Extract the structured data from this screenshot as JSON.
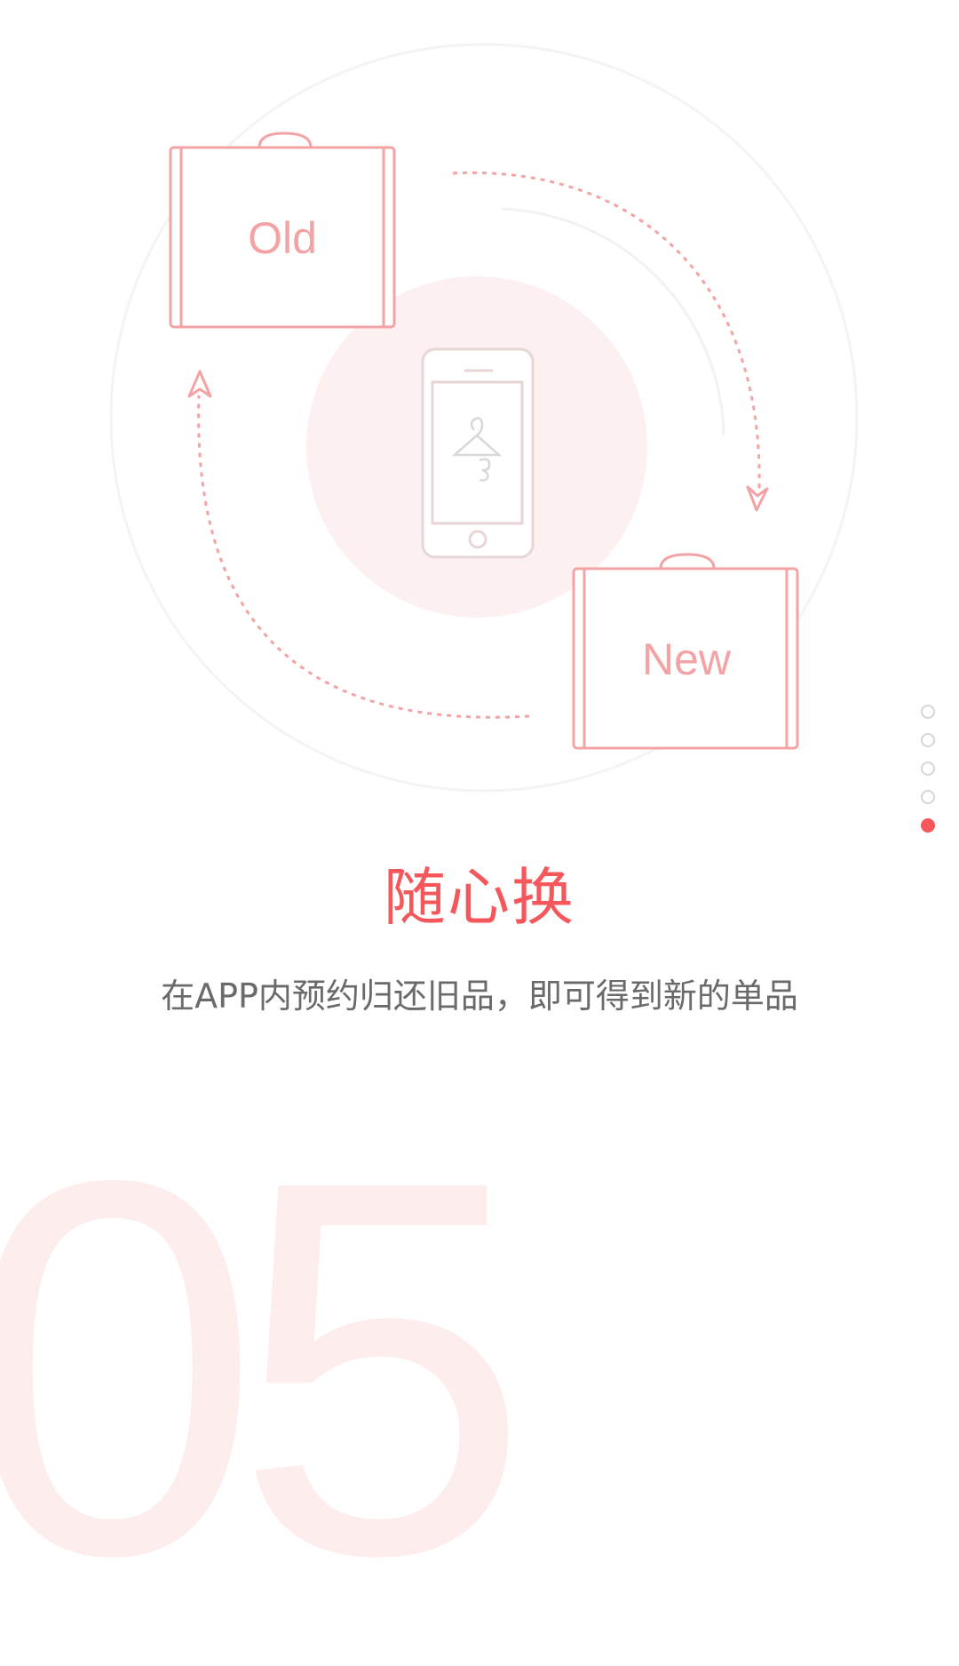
{
  "illustration": {
    "old_bag_label": "Old",
    "new_bag_label": "New"
  },
  "pager": {
    "total": 5,
    "active_index": 5
  },
  "title": "随心换",
  "subtitle": "在APP内预约归还旧品，即可得到新的单品",
  "step_number": "05",
  "colors": {
    "accent": "#f5575a",
    "line": "#f3a3a4",
    "soft_bg": "#fdf0f0",
    "number_bg": "#fdeded"
  }
}
